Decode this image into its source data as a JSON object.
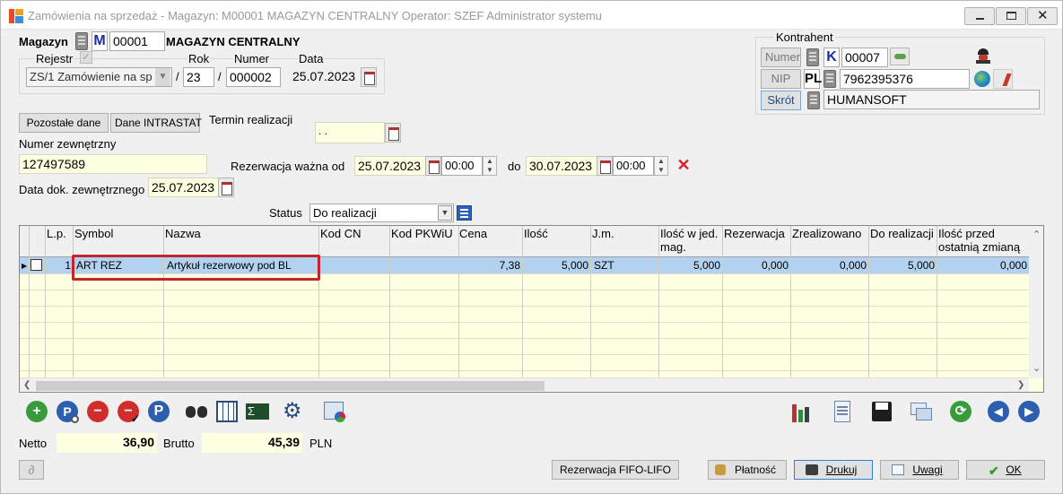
{
  "window": {
    "title": "Zamówienia na sprzedaż - Magazyn: M00001 MAGAZYN CENTRALNY  Operator: SZEF Administrator systemu"
  },
  "header": {
    "magazyn_label": "Magazyn",
    "magazyn_letter": "M",
    "magazyn_code": "00001",
    "magazyn_name": "MAGAZYN CENTRALNY",
    "rejestr_label": "Rejestr",
    "rejestr_value": "ZS/1 Zamówienie na sp",
    "rok_label": "Rok",
    "rok_value": "23",
    "numer_label": "Numer",
    "numer_value": "000002",
    "data_label": "Data",
    "data_value": "25.07.2023",
    "slash": "/"
  },
  "kontrahent": {
    "label": "Kontrahent",
    "numer_button": "Numer",
    "numer_letter": "K",
    "numer_value": "00007",
    "nip_button": "NIP",
    "nip_prefix": "PL",
    "nip_value": "7962395376",
    "skrot_button": "Skrót",
    "skrot_value": "HUMANSOFT"
  },
  "buttons": {
    "pozostale": "Pozostałe dane",
    "intrastat": "Dane INTRASTAT",
    "fifo": "Rezerwacja FIFO-LIFO",
    "platnosc": "Płatność",
    "drukuj": "Drukuj",
    "uwagi": "Uwagi",
    "ok": "OK"
  },
  "termin": {
    "label": "Termin realizacji",
    "value": " . ."
  },
  "numer_zewnetrzny": {
    "label": "Numer zewnętrzny",
    "value": "127497589"
  },
  "rezerwacja": {
    "label": "Rezerwacja  ważna od",
    "od_date": "25.07.2023",
    "od_time": "00:00",
    "do_label": "do",
    "do_date": "30.07.2023",
    "do_time": "00:00"
  },
  "data_dok": {
    "label": "Data dok. zewnętrznego",
    "value": "25.07.2023"
  },
  "status": {
    "label": "Status",
    "value": "Do realizacji"
  },
  "table": {
    "columns": [
      "L.p.",
      "Symbol",
      "Nazwa",
      "Kod  CN",
      "Kod  PKWiU",
      "Cena",
      "Ilość",
      "J.m.",
      "Ilość w jed. mag.",
      "Rezerwacja",
      "Zrealizowano",
      "Do realizacji",
      "Ilość przed ostatnią zmianą"
    ],
    "rows": [
      {
        "lp": "1",
        "symbol": "ART REZ",
        "nazwa": "Artykuł rezerwowy pod BL",
        "kod_cn": "",
        "kod_pkwiu": "",
        "cena": "7,38",
        "ilosc": "5,000",
        "jm": "SZT",
        "ilosc_mag": "5,000",
        "rezerwacja": "0,000",
        "zrealizowano": "0,000",
        "do_realizacji": "5,000",
        "ilosc_przed": "0,000"
      }
    ]
  },
  "totals": {
    "netto_label": "Netto",
    "netto_value": "36,90",
    "brutto_label": "Brutto",
    "brutto_value": "45,39",
    "currency": "PLN"
  },
  "colors": {
    "highlight": "#c0262b",
    "selected_row": "#b3d2f0",
    "field_yellow": "#ffffe1"
  }
}
